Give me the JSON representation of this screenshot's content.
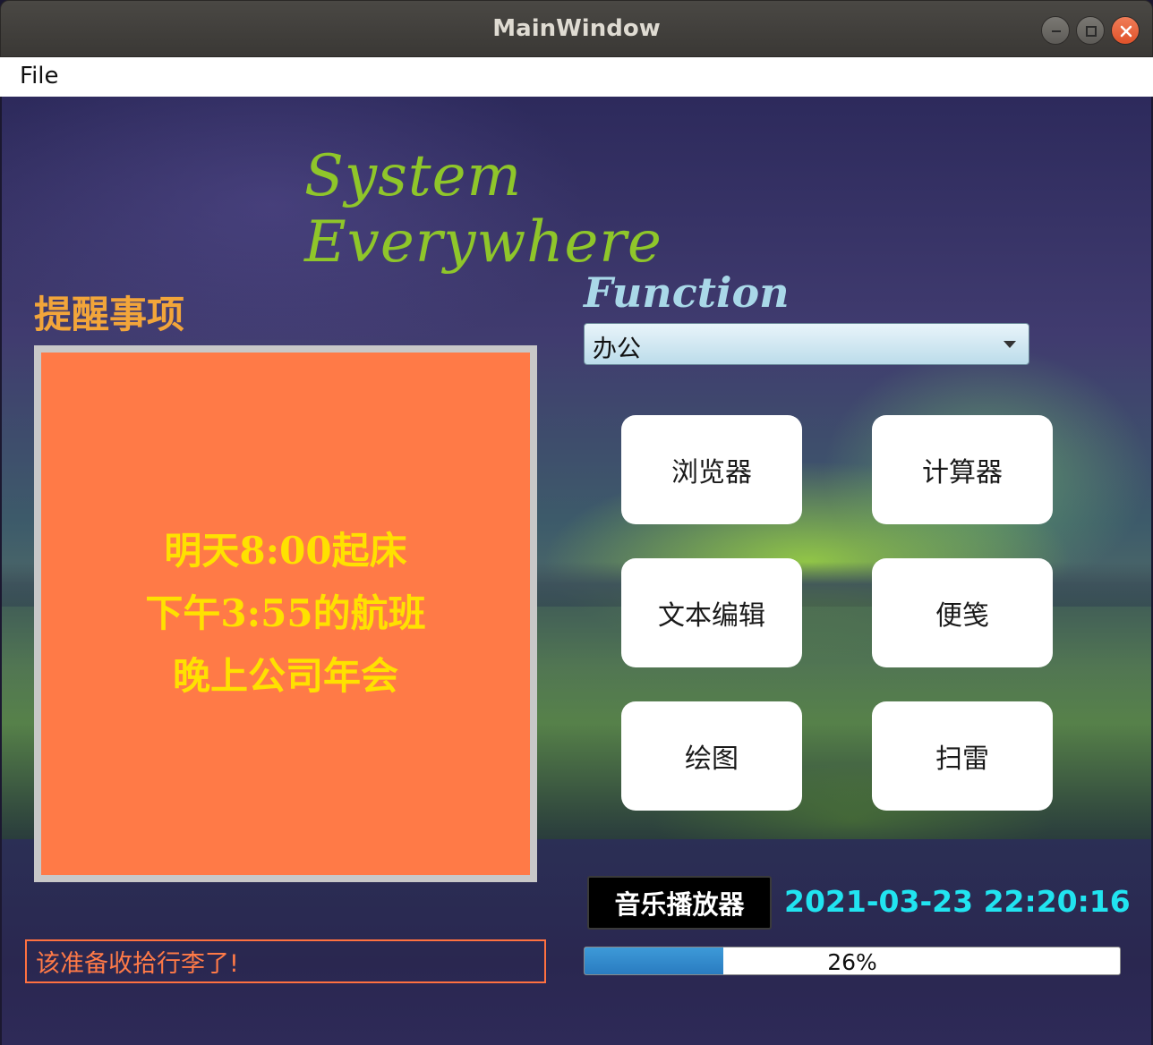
{
  "window": {
    "title": "MainWindow"
  },
  "menubar": {
    "items": [
      "File"
    ]
  },
  "banner": {
    "text": "System  Everywhere"
  },
  "reminders": {
    "title": "提醒事项",
    "lines": [
      "明天8:00起床",
      "下午3:55的航班",
      "晚上公司年会"
    ]
  },
  "function": {
    "label": "Function",
    "category_selected": "办公",
    "buttons": [
      "浏览器",
      "计算器",
      "文本编辑",
      "便笺",
      "绘图",
      "扫雷"
    ]
  },
  "music_button": "音乐播放器",
  "datetime": "2021-03-23 22:20:16",
  "status_message": "该准备收拾行李了!",
  "progress": {
    "value": 0.26,
    "text": "26%"
  },
  "colors": {
    "headline": "#8fc62a",
    "reminder_title": "#f2a53a",
    "reminder_bg": "#ff7a47",
    "reminder_text": "#ffe100",
    "datetime": "#21e4f0",
    "status": "#ff7a47",
    "progress_fill": "#2f86c8"
  },
  "icons": [
    "minimize-icon",
    "maximize-icon",
    "close-icon",
    "dropdown-arrow-icon"
  ]
}
